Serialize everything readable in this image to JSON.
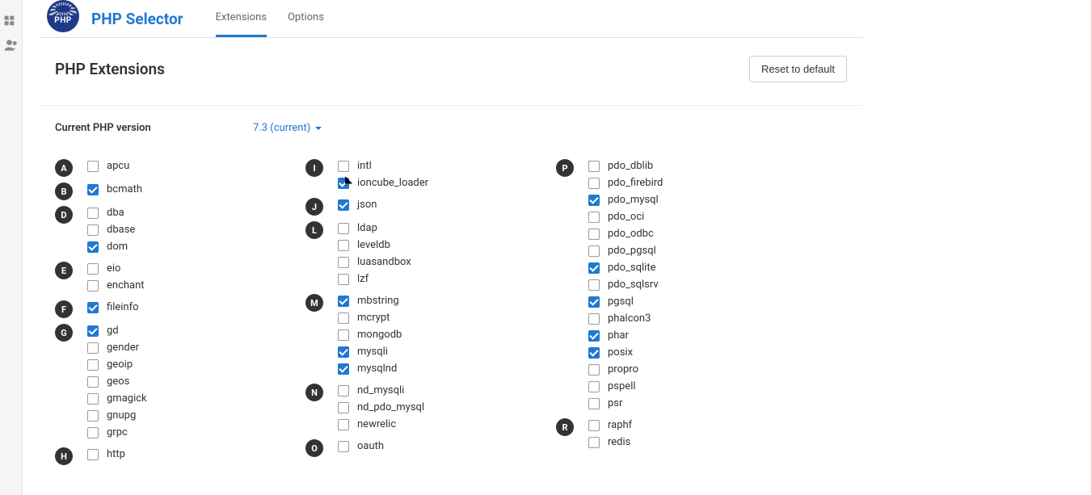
{
  "app": {
    "logo_text": "PHP",
    "title": "PHP Selector",
    "tabs": [
      {
        "label": "Extensions",
        "active": true
      },
      {
        "label": "Options",
        "active": false
      }
    ]
  },
  "page": {
    "section_title": "PHP Extensions",
    "reset_button": "Reset to default",
    "version_label": "Current PHP version",
    "version_value": "7.3 (current)"
  },
  "columns": [
    [
      {
        "letter": "A",
        "items": [
          {
            "name": "apcu",
            "checked": false
          }
        ]
      },
      {
        "letter": "B",
        "items": [
          {
            "name": "bcmath",
            "checked": true
          }
        ]
      },
      {
        "letter": "D",
        "items": [
          {
            "name": "dba",
            "checked": false
          },
          {
            "name": "dbase",
            "checked": false
          },
          {
            "name": "dom",
            "checked": true
          }
        ]
      },
      {
        "letter": "E",
        "items": [
          {
            "name": "eio",
            "checked": false
          },
          {
            "name": "enchant",
            "checked": false
          }
        ]
      },
      {
        "letter": "F",
        "items": [
          {
            "name": "fileinfo",
            "checked": true
          }
        ]
      },
      {
        "letter": "G",
        "items": [
          {
            "name": "gd",
            "checked": true
          },
          {
            "name": "gender",
            "checked": false
          },
          {
            "name": "geoip",
            "checked": false
          },
          {
            "name": "geos",
            "checked": false
          },
          {
            "name": "gmagick",
            "checked": false
          },
          {
            "name": "gnupg",
            "checked": false
          },
          {
            "name": "grpc",
            "checked": false
          }
        ]
      },
      {
        "letter": "H",
        "items": [
          {
            "name": "http",
            "checked": false
          }
        ]
      }
    ],
    [
      {
        "letter": "I",
        "items": [
          {
            "name": "intl",
            "checked": false
          },
          {
            "name": "ioncube_loader",
            "checked": true
          }
        ]
      },
      {
        "letter": "J",
        "items": [
          {
            "name": "json",
            "checked": true
          }
        ]
      },
      {
        "letter": "L",
        "items": [
          {
            "name": "ldap",
            "checked": false
          },
          {
            "name": "leveldb",
            "checked": false
          },
          {
            "name": "luasandbox",
            "checked": false
          },
          {
            "name": "lzf",
            "checked": false
          }
        ]
      },
      {
        "letter": "M",
        "items": [
          {
            "name": "mbstring",
            "checked": true
          },
          {
            "name": "mcrypt",
            "checked": false
          },
          {
            "name": "mongodb",
            "checked": false
          },
          {
            "name": "mysqli",
            "checked": true
          },
          {
            "name": "mysqlnd",
            "checked": true
          }
        ]
      },
      {
        "letter": "N",
        "items": [
          {
            "name": "nd_mysqli",
            "checked": false
          },
          {
            "name": "nd_pdo_mysql",
            "checked": false
          },
          {
            "name": "newrelic",
            "checked": false
          }
        ]
      },
      {
        "letter": "O",
        "items": [
          {
            "name": "oauth",
            "checked": false
          }
        ]
      }
    ],
    [
      {
        "letter": "P",
        "items": [
          {
            "name": "pdo_dblib",
            "checked": false
          },
          {
            "name": "pdo_firebird",
            "checked": false
          },
          {
            "name": "pdo_mysql",
            "checked": true
          },
          {
            "name": "pdo_oci",
            "checked": false
          },
          {
            "name": "pdo_odbc",
            "checked": false
          },
          {
            "name": "pdo_pgsql",
            "checked": false
          },
          {
            "name": "pdo_sqlite",
            "checked": true
          },
          {
            "name": "pdo_sqlsrv",
            "checked": false
          },
          {
            "name": "pgsql",
            "checked": true
          },
          {
            "name": "phalcon3",
            "checked": false
          },
          {
            "name": "phar",
            "checked": true
          },
          {
            "name": "posix",
            "checked": true
          },
          {
            "name": "propro",
            "checked": false
          },
          {
            "name": "pspell",
            "checked": false
          },
          {
            "name": "psr",
            "checked": false
          }
        ]
      },
      {
        "letter": "R",
        "items": [
          {
            "name": "raphf",
            "checked": false
          },
          {
            "name": "redis",
            "checked": false
          }
        ]
      }
    ]
  ]
}
